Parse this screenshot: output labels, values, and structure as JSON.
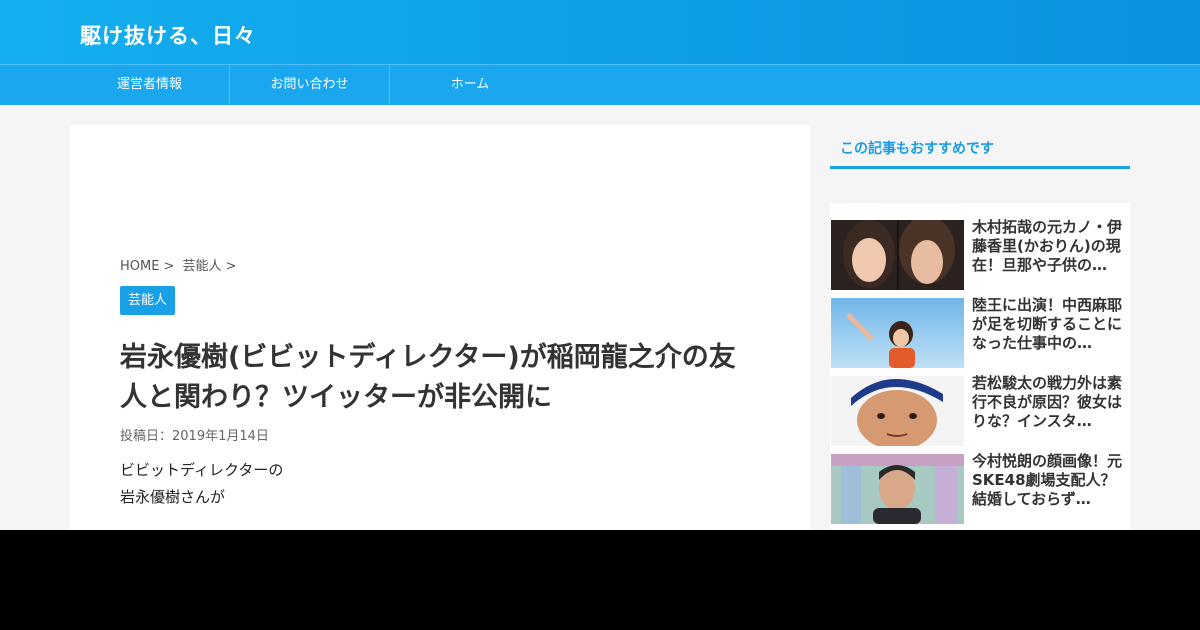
{
  "site": {
    "title": "駆け抜ける、日々"
  },
  "nav": {
    "items": [
      "運営者情報",
      "お問い合わせ",
      "ホーム"
    ]
  },
  "breadcrumb": {
    "home": "HOME",
    "sep": ">",
    "category": "芸能人"
  },
  "post": {
    "category": "芸能人",
    "title": "岩永優樹(ビビットディレクター)が稲岡龍之介の友人と関わり？ツイッターが非公開に",
    "date": "投稿日：2019年1月14日",
    "body": [
      "ビビットディレクターの",
      "岩永優樹さんが"
    ]
  },
  "sidebar": {
    "heading": "この記事もおすすめです",
    "items": [
      {
        "title": "木村拓哉の元カノ・伊藤香里(かおりん)の現在！旦那や子供の…"
      },
      {
        "title": "陸王に出演！中西麻耶が足を切断することになった仕事中の…"
      },
      {
        "title": "若松駿太の戦力外は素行不良が原因？彼女はりな？インスタ…"
      },
      {
        "title": "今村悦朗の顔画像！元SKE48劇場支配人？結婚しておらず…"
      }
    ]
  }
}
